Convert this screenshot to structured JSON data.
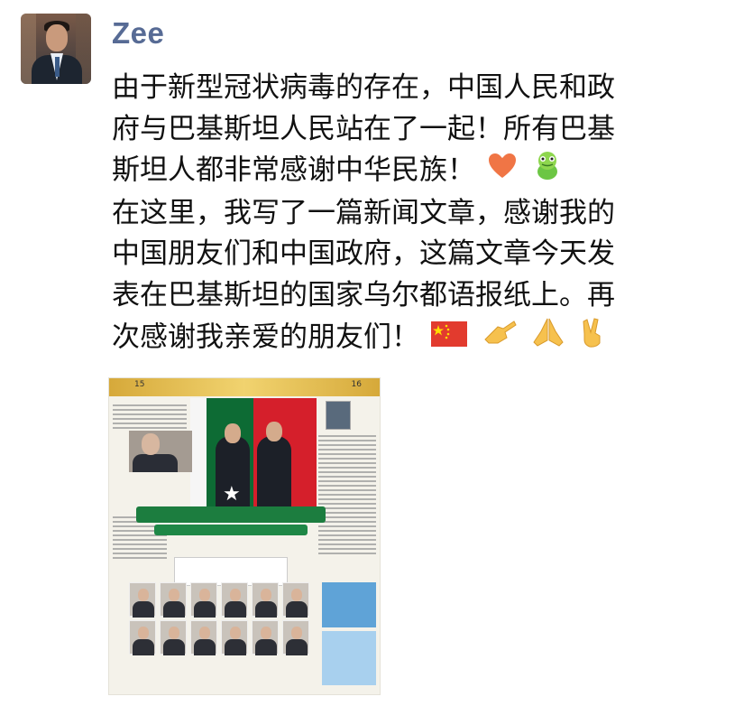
{
  "post": {
    "author": "Zee",
    "message_lines": [
      "由于新型冠状病毒的存在，中国人民和政",
      "府与巴基斯坦人民站在了一起！所有巴基",
      "斯坦人都非常感谢中华民族！",
      "在这里，我写了一篇新闻文章，感谢我的",
      "中国朋友们和中国政府，这篇文章今天发",
      "表在巴基斯坦的国家乌尔都语报纸上。再",
      "次感谢我亲爱的朋友们！"
    ],
    "emoji_line3": [
      "heart-icon",
      "pepe-frog-icon"
    ],
    "emoji_line7": [
      "china-flag-icon",
      "pointing-hand-icon",
      "praying-hands-icon",
      "victory-hand-icon"
    ]
  },
  "newspaper": {
    "page_left": "15",
    "page_right": "16",
    "colors": {
      "pakistan_green": "#0d6b34",
      "china_red": "#d51f2b",
      "gold": "#d6a93a"
    }
  }
}
